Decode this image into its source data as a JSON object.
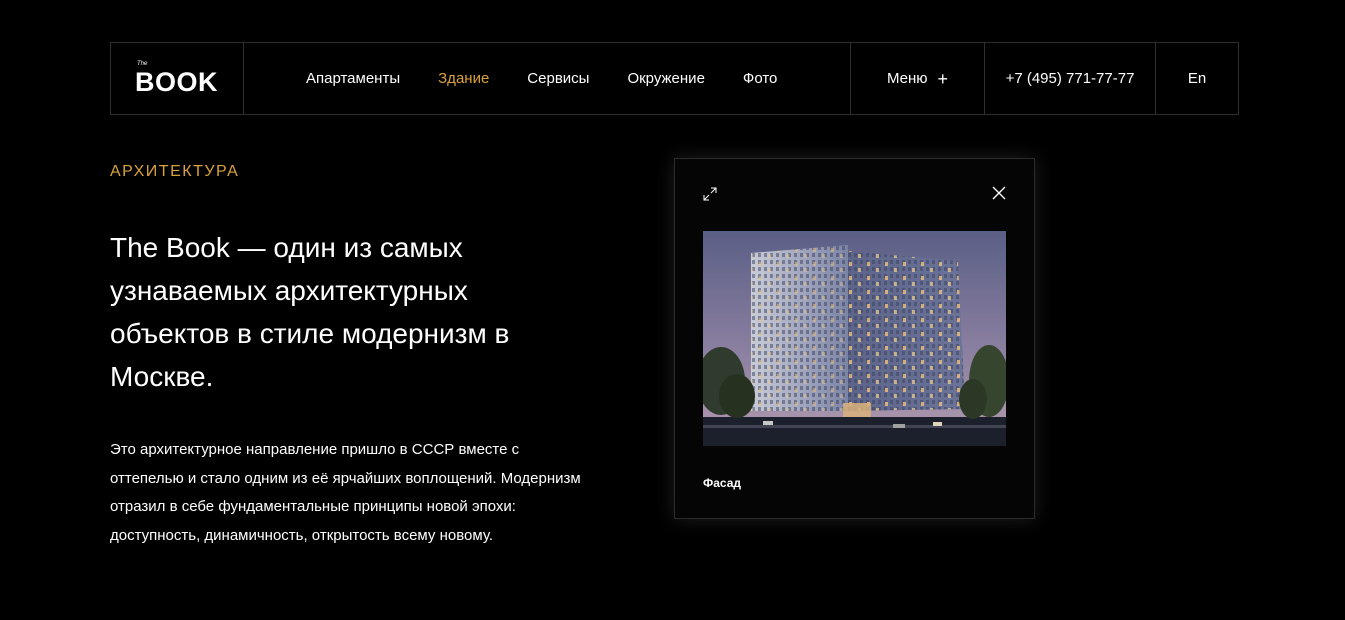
{
  "header": {
    "logo_small": "The",
    "logo_big": "BOOK",
    "nav": [
      {
        "label": "Апартаменты",
        "active": false
      },
      {
        "label": "Здание",
        "active": true
      },
      {
        "label": "Сервисы",
        "active": false
      },
      {
        "label": "Окружение",
        "active": false
      },
      {
        "label": "Фото",
        "active": false
      }
    ],
    "menu_label": "Меню",
    "menu_icon": "plus-icon",
    "phone": "+7 (495) 771-77-77",
    "lang": "En"
  },
  "main": {
    "section_label": "АРХИТЕКТУРА",
    "headline": "The Book — один из самых узнаваемых архитектурных объектов в стиле модернизм в Москве.",
    "body": "Это архитектурное направление пришло в СССР вместе с оттепелью и стало одним из её ярчайших воплощений. Модернизм отразил в себе фундаментальные принципы новой эпохи: доступность, динамичность, открытость всему новому."
  },
  "modal": {
    "caption": "Фасад",
    "expand_icon": "expand-icon",
    "close_icon": "close-icon"
  },
  "colors": {
    "background": "#000000",
    "accent": "#d9a23a",
    "text": "#ffffff",
    "border": "#2f2f2f"
  }
}
